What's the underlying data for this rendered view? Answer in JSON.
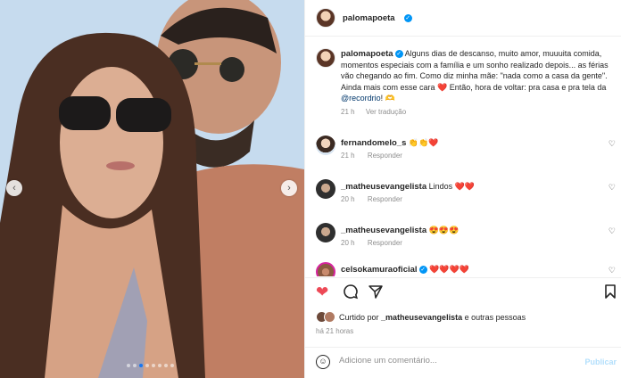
{
  "post": {
    "author": "palomapoeta",
    "caption_parts": {
      "text1": "Alguns dias de descanso, muito amor, muuuita comida, momentos especiais com a família e um sonho realizado depois... as férias vão chegando ao fim. Como diz minha mãe: \"nada como a casa da gente\". Ainda mais com esse cara ❤️ Então, hora de voltar: pra casa e pra tela da ",
      "mention": "@recordrio",
      "text2": "! 🫶"
    },
    "caption_time": "21 h",
    "translate_label": "Ver tradução",
    "carousel": {
      "slides": 8,
      "active_index": 2
    }
  },
  "comments": [
    {
      "user": "fernandomelo_s",
      "text": "👏👏❤️",
      "time": "21 h",
      "reply": "Responder",
      "verified": false
    },
    {
      "user": "_matheusevangelista",
      "text": "Lindos ❤️❤️",
      "time": "20 h",
      "reply": "Responder",
      "verified": false
    },
    {
      "user": "_matheusevangelista",
      "text": "😍😍😍",
      "time": "20 h",
      "reply": "Responder",
      "verified": false
    },
    {
      "user": "celsokamuraoficial",
      "text": "❤️❤️❤️❤️",
      "time": "",
      "reply": "",
      "verified": true
    }
  ],
  "likes": {
    "prefix": "Curtido por ",
    "user": "_matheusevangelista",
    "suffix": " e outras pessoas"
  },
  "post_time": "há 21 horas",
  "comment_box": {
    "placeholder": "Adicione um comentário...",
    "publish": "Publicar"
  },
  "icons": {
    "like": "heart-filled-icon",
    "comment": "comment-icon",
    "share": "send-icon",
    "save": "bookmark-icon",
    "emoji": "emoji-icon",
    "carousel_prev": "chevron-left-icon",
    "carousel_next": "chevron-right-icon",
    "verified": "verified-badge-icon"
  },
  "colors": {
    "like_red": "#ed4956",
    "verified_blue": "#0095f6",
    "publish_disabled": "#b2dffc"
  }
}
